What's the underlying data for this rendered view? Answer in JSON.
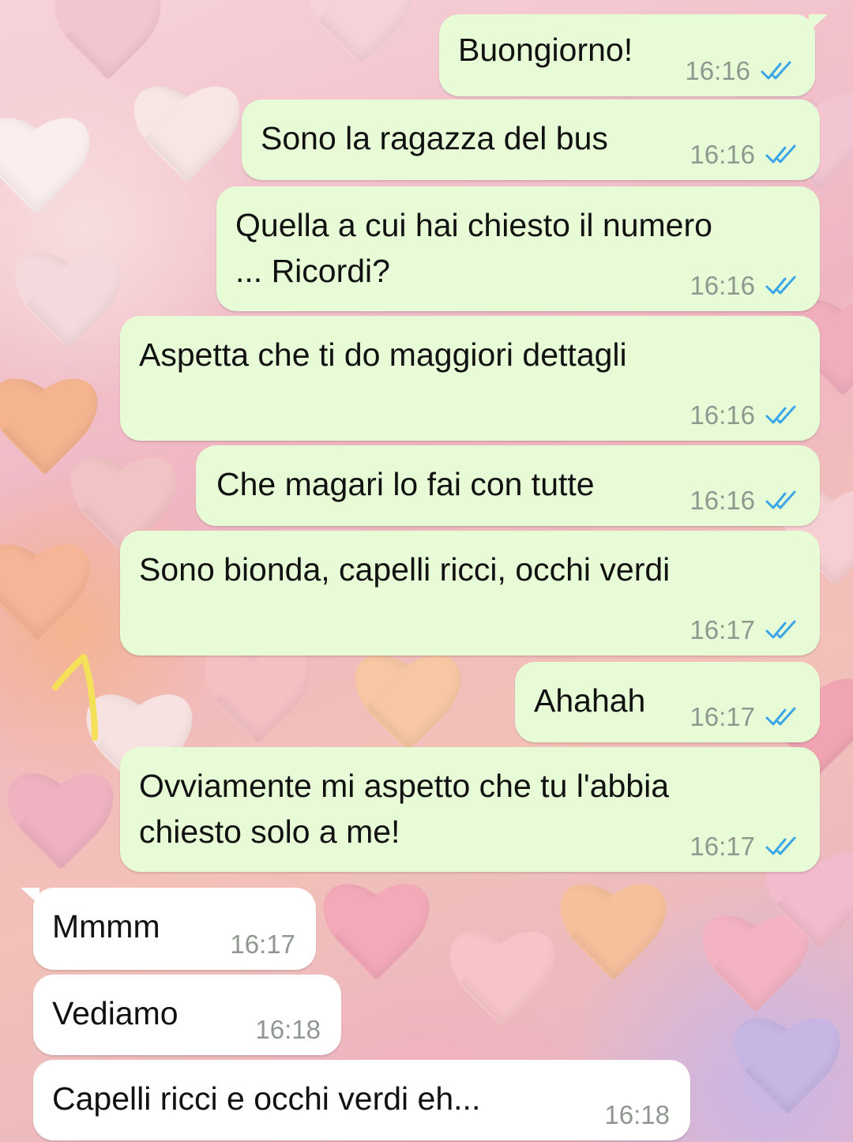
{
  "chat": {
    "messages": [
      {
        "direction": "out",
        "lines": [
          "Buongiorno!"
        ],
        "time": "16:16",
        "status": "read"
      },
      {
        "direction": "out",
        "lines": [
          "Sono la ragazza del bus"
        ],
        "time": "16:16",
        "status": "read"
      },
      {
        "direction": "out",
        "lines": [
          "Quella a cui hai chiesto il numero",
          "... Ricordi?"
        ],
        "time": "16:16",
        "status": "read"
      },
      {
        "direction": "out",
        "lines": [
          "Aspetta che ti do maggiori dettagli"
        ],
        "time": "16:16",
        "status": "read"
      },
      {
        "direction": "out",
        "lines": [
          "Che magari lo fai con tutte"
        ],
        "time": "16:16",
        "status": "read"
      },
      {
        "direction": "out",
        "lines": [
          "Sono bionda, capelli ricci, occhi verdi"
        ],
        "time": "16:17",
        "status": "read"
      },
      {
        "direction": "out",
        "lines": [
          "Ahahah"
        ],
        "time": "16:17",
        "status": "read"
      },
      {
        "direction": "out",
        "lines": [
          "Ovviamente mi aspetto che tu l'abbia",
          "chiesto solo a me!"
        ],
        "time": "16:17",
        "status": "read"
      },
      {
        "direction": "in",
        "lines": [
          "Mmmm"
        ],
        "time": "16:17"
      },
      {
        "direction": "in",
        "lines": [
          "Vediamo"
        ],
        "time": "16:18"
      },
      {
        "direction": "in",
        "lines": [
          "Capelli ricci e occhi verdi eh..."
        ],
        "time": "16:18"
      }
    ]
  },
  "colors": {
    "outgoing_bubble": "#e7fcd6",
    "incoming_bubble": "#ffffff",
    "read_ticks": "#3aa6e8",
    "annotation_marker": "#f5e05a"
  },
  "icons": {
    "read_status": "double-check-icon",
    "annotation": "hand-drawn-arrow-icon"
  }
}
